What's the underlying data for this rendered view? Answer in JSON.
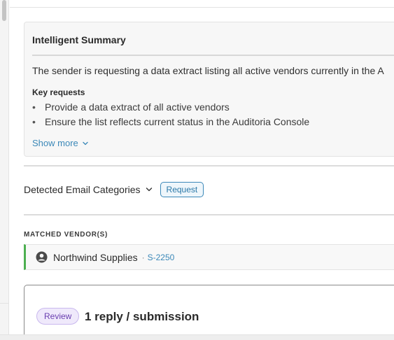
{
  "summary": {
    "title": "Intelligent Summary",
    "text": "The sender is requesting a data extract listing all active vendors currently in the A",
    "key_requests_label": "Key requests",
    "bullets": [
      "Provide a data extract of all active vendors",
      "Ensure the list reflects current status in the Auditoria Console"
    ],
    "show_more_label": "Show more"
  },
  "categories": {
    "label": "Detected Email Categories",
    "badge": "Request"
  },
  "matched": {
    "label": "MATCHED VENDOR(S)",
    "vendor_name": "Northwind Supplies",
    "separator": "·",
    "vendor_id": "S-2250"
  },
  "review": {
    "badge": "Review",
    "title": "1 reply / submission"
  },
  "colors": {
    "accent": "#3b88b8",
    "vendor_border": "#4caf50",
    "review_badge": "#6a3fb0"
  },
  "icons": [
    "chevron-down-icon",
    "user-circle-icon"
  ]
}
